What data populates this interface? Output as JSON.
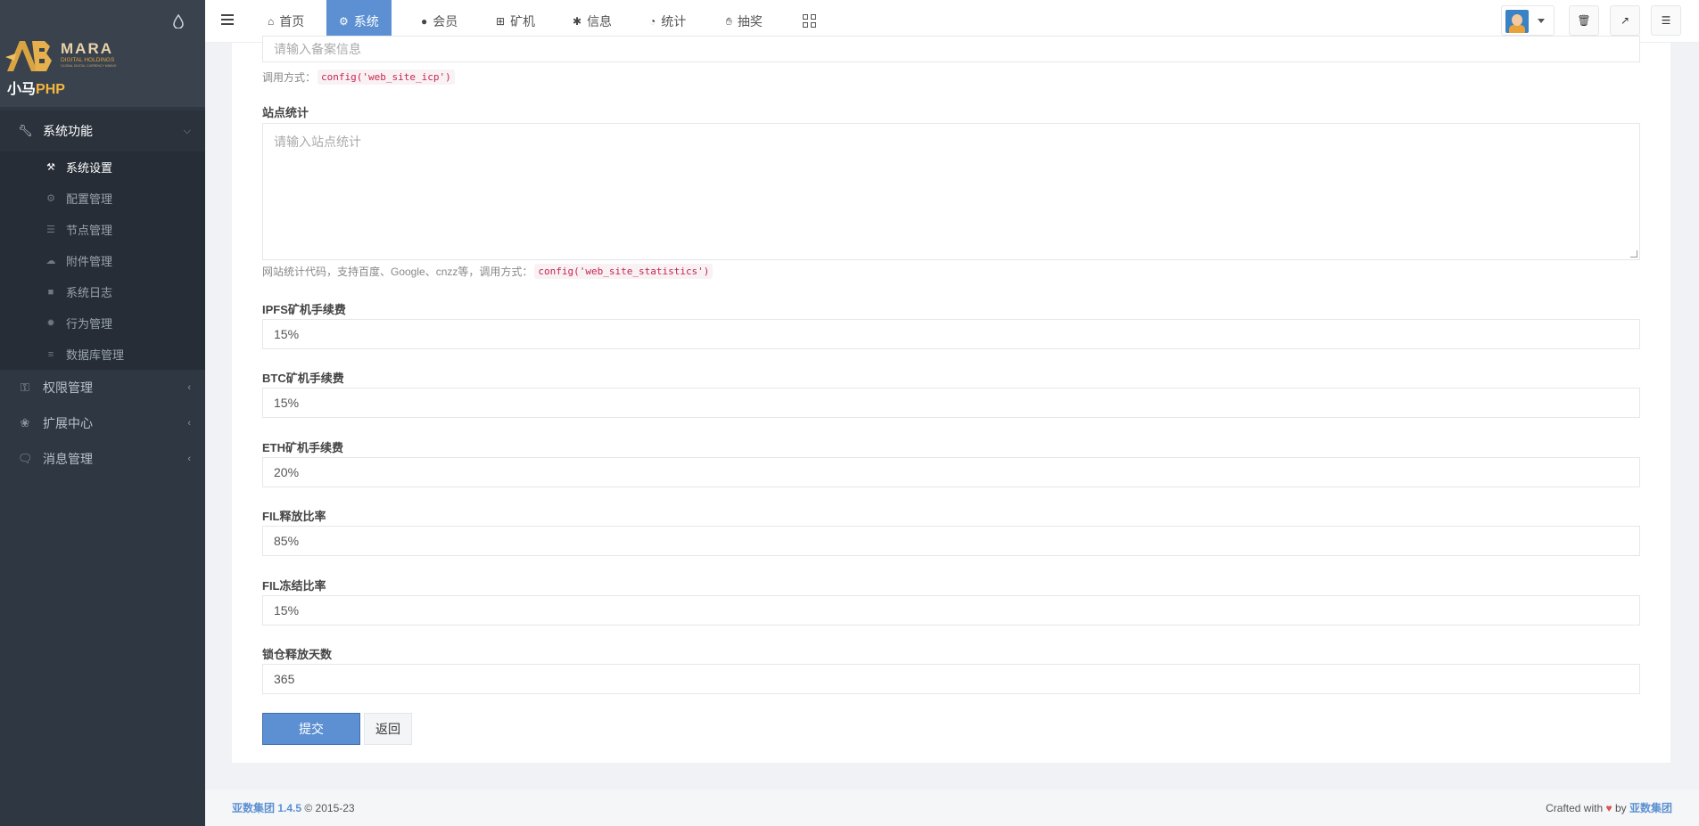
{
  "sidebar": {
    "brand_sub_text": "小马",
    "brand_sub_php": "PHP",
    "groups": [
      {
        "label": "系统功能",
        "icon": "wrench-icon"
      },
      {
        "label": "权限管理",
        "icon": "key-icon"
      },
      {
        "label": "扩展中心",
        "icon": "puzzle-icon"
      },
      {
        "label": "消息管理",
        "icon": "comments-icon"
      }
    ],
    "subitems": [
      {
        "label": "系统设置",
        "icon": "wrench-icon"
      },
      {
        "label": "配置管理",
        "icon": "cogs-icon"
      },
      {
        "label": "节点管理",
        "icon": "list-icon"
      },
      {
        "label": "附件管理",
        "icon": "cloud-upload-icon"
      },
      {
        "label": "系统日志",
        "icon": "book-icon"
      },
      {
        "label": "行为管理",
        "icon": "bug-icon"
      },
      {
        "label": "数据库管理",
        "icon": "database-icon"
      }
    ]
  },
  "topbar": {
    "tabs": [
      {
        "label": "首页",
        "icon": "home-icon"
      },
      {
        "label": "系统",
        "icon": "gear-icon"
      },
      {
        "label": "会员",
        "icon": "user-icon"
      },
      {
        "label": "矿机",
        "icon": "windows-icon"
      },
      {
        "label": "信息",
        "icon": "yelp-icon"
      },
      {
        "label": "统计",
        "icon": "pie-chart-icon"
      },
      {
        "label": "抽奖",
        "icon": "hand-icon"
      }
    ]
  },
  "form": {
    "icp_placeholder": "请输入备案信息",
    "icp_help_prefix": "调用方式：",
    "icp_help_code": "config('web_site_icp')",
    "stats_label": "站点统计",
    "stats_placeholder": "请输入站点统计",
    "stats_help_prefix": "网站统计代码，支持百度、Google、cnzz等，调用方式：",
    "stats_help_code": "config('web_site_statistics')",
    "fields": [
      {
        "label": "IPFS矿机手续费",
        "value": "15%"
      },
      {
        "label": "BTC矿机手续费",
        "value": "15%"
      },
      {
        "label": "ETH矿机手续费",
        "value": "20%"
      },
      {
        "label": "FIL释放比率",
        "value": "85%"
      },
      {
        "label": "FIL冻结比率",
        "value": "15%"
      },
      {
        "label": "锁仓释放天数",
        "value": "365"
      }
    ],
    "submit_label": "提交",
    "back_label": "返回"
  },
  "footer": {
    "brand": "亚数集团 1.4.5",
    "copyright": "© 2015-23",
    "crafted": "Crafted with",
    "by": "by",
    "author": "亚数集团"
  },
  "colors": {
    "accent": "#5c90d2",
    "sidebar": "#2f3742"
  }
}
